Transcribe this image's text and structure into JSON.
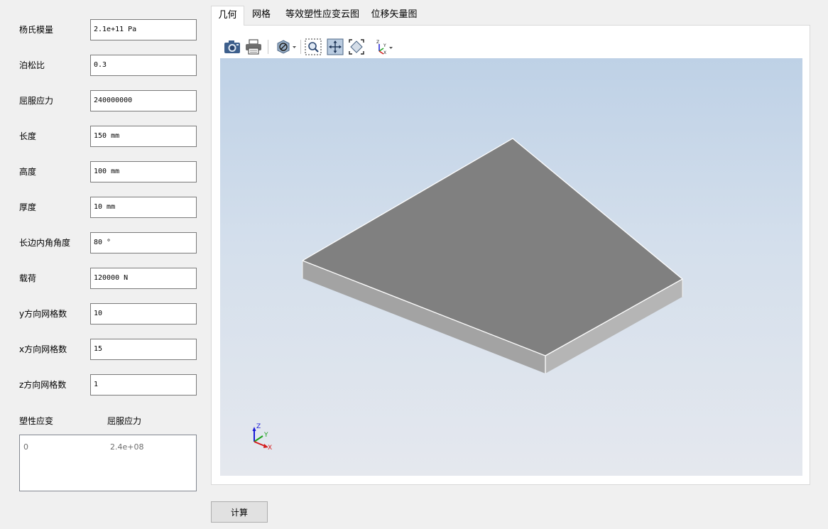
{
  "form": {
    "fields": [
      {
        "label": "杨氏模量",
        "value": "2.1e+11 Pa"
      },
      {
        "label": "泊松比",
        "value": "0.3"
      },
      {
        "label": "屈服应力",
        "value": "240000000"
      },
      {
        "label": "长度",
        "value": "150 mm"
      },
      {
        "label": "高度",
        "value": "100 mm"
      },
      {
        "label": "厚度",
        "value": "10 mm"
      },
      {
        "label": "长边内角角度",
        "value": "80 °"
      },
      {
        "label": "载荷",
        "value": "120000 N"
      },
      {
        "label": "y方向网格数",
        "value": "10"
      },
      {
        "label": "x方向网格数",
        "value": "15"
      },
      {
        "label": "z方向网格数",
        "value": "1"
      }
    ]
  },
  "table": {
    "columns": [
      "塑性应变",
      "屈服应力"
    ],
    "rows": [
      [
        "0",
        "2.4e+08"
      ]
    ]
  },
  "tabs": [
    "几何",
    "网格",
    "等效塑性应变云图",
    "位移矢量图"
  ],
  "active_tab": "几何",
  "toolbar": {
    "icons": [
      "camera-icon",
      "print-icon",
      "visibility-icon",
      "zoom-region-icon",
      "pan-icon",
      "fit-all-icon",
      "axes-view-icon"
    ]
  },
  "viewport": {
    "triad": {
      "x": "X",
      "y": "Y",
      "z": "Z"
    },
    "colors": {
      "top_face": "#808080",
      "side_face": "#a9a9a9",
      "edge": "#ffffff",
      "bg_top": "#bed1e6",
      "bg_bottom": "#e5e8ee"
    }
  },
  "buttons": {
    "calculate": "计算"
  }
}
